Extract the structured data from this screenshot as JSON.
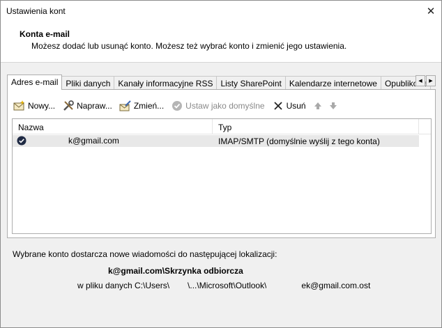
{
  "window": {
    "title": "Ustawienia kont",
    "close_glyph": "✕"
  },
  "header": {
    "title": "Konta e-mail",
    "description": "Możesz dodać lub usunąć konto. Możesz też wybrać konto i zmienić jego ustawienia."
  },
  "tabs": [
    {
      "label": "Adres e-mail",
      "active": true
    },
    {
      "label": "Pliki danych"
    },
    {
      "label": "Kanały informacyjne RSS"
    },
    {
      "label": "Listy SharePoint"
    },
    {
      "label": "Kalendarze internetowe"
    },
    {
      "label": "Opublikowane kalendarze"
    }
  ],
  "tab_scroll": {
    "left": "◀",
    "right": "▶"
  },
  "toolbar": {
    "new_label": "Nowy...",
    "repair_label": "Napraw...",
    "change_label": "Zmień...",
    "set_default_label": "Ustaw jako domyślne",
    "remove_label": "Usuń"
  },
  "list": {
    "columns": [
      "Nazwa",
      "Typ"
    ],
    "rows": [
      {
        "name_suffix": "k@gmail.com",
        "type": "IMAP/SMTP (domyślnie wyślij z tego konta)"
      }
    ]
  },
  "info": {
    "line1": "Wybrane konto dostarcza nowe wiadomości do następującej lokalizacji:",
    "line2_suffix": "k@gmail.com\\Skrzynka odbiorcza",
    "line3_prefix": "w pliku danych C:\\Users\\",
    "line3_middle": "\\...\\Microsoft\\Outlook\\",
    "line3_suffix": "ek@gmail.com.ost"
  },
  "colors": {
    "selected_row": "#e8e8e8",
    "accent": "#1f2a44"
  }
}
